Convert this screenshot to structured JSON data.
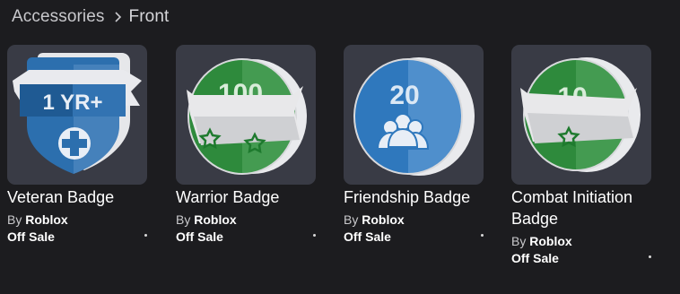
{
  "breadcrumb": {
    "items": [
      "Accessories",
      "Front"
    ]
  },
  "items": [
    {
      "name": "Veteran Badge",
      "by_label": "By",
      "creator": "Roblox",
      "status": "Off Sale",
      "badge_text": "1 YR+",
      "badge_color": "#2f74b5"
    },
    {
      "name": "Warrior Badge",
      "by_label": "By",
      "creator": "Roblox",
      "status": "Off Sale",
      "badge_text": "100",
      "badge_color": "#2e8a3c"
    },
    {
      "name": "Friendship Badge",
      "by_label": "By",
      "creator": "Roblox",
      "status": "Off Sale",
      "badge_text": "20",
      "badge_color": "#2f78bd"
    },
    {
      "name": "Combat Initiation Badge",
      "by_label": "By",
      "creator": "Roblox",
      "status": "Off Sale",
      "badge_text": "10",
      "badge_color": "#2e8a3c"
    }
  ]
}
